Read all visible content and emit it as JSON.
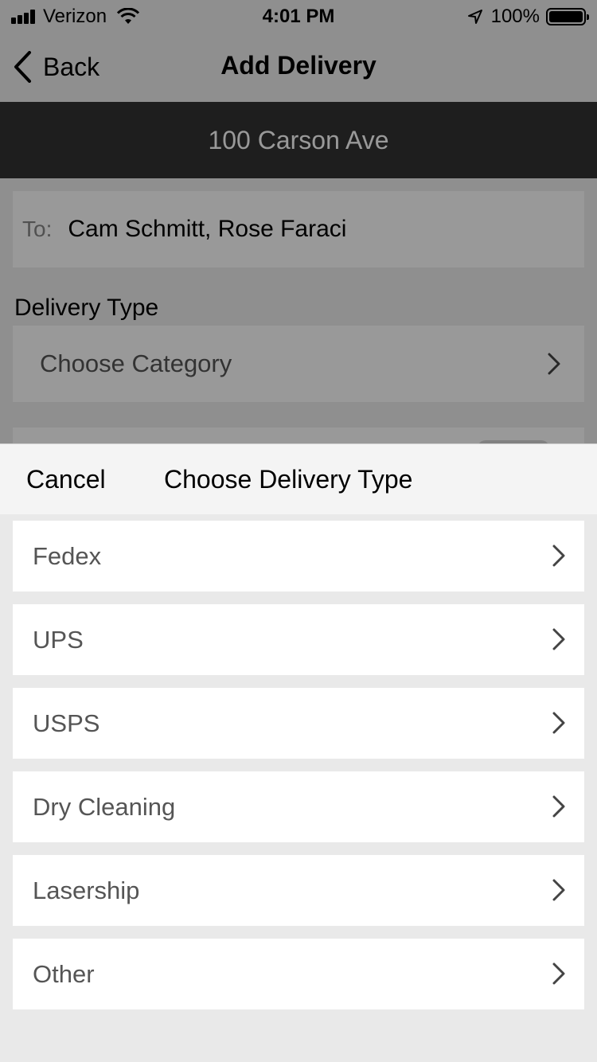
{
  "status_bar": {
    "carrier": "Verizon",
    "time": "4:01 PM",
    "battery": "100%"
  },
  "nav": {
    "back_label": "Back",
    "title": "Add Delivery"
  },
  "address": "100 Carson Ave",
  "form": {
    "to_label": "To:",
    "to_value": "Cam Schmitt, Rose Faraci",
    "delivery_type_label": "Delivery Type",
    "category_placeholder": "Choose Category"
  },
  "sheet": {
    "cancel_label": "Cancel",
    "title": "Choose Delivery Type",
    "options": [
      {
        "label": "Fedex"
      },
      {
        "label": "UPS"
      },
      {
        "label": "USPS"
      },
      {
        "label": "Dry Cleaning"
      },
      {
        "label": "Lasership"
      },
      {
        "label": "Other"
      }
    ]
  },
  "icons": {
    "signal": "cell-signal-icon",
    "wifi": "wifi-icon",
    "location": "location-arrow-icon",
    "battery": "battery-icon",
    "back": "chevron-left-icon",
    "row": "chevron-right-icon"
  }
}
